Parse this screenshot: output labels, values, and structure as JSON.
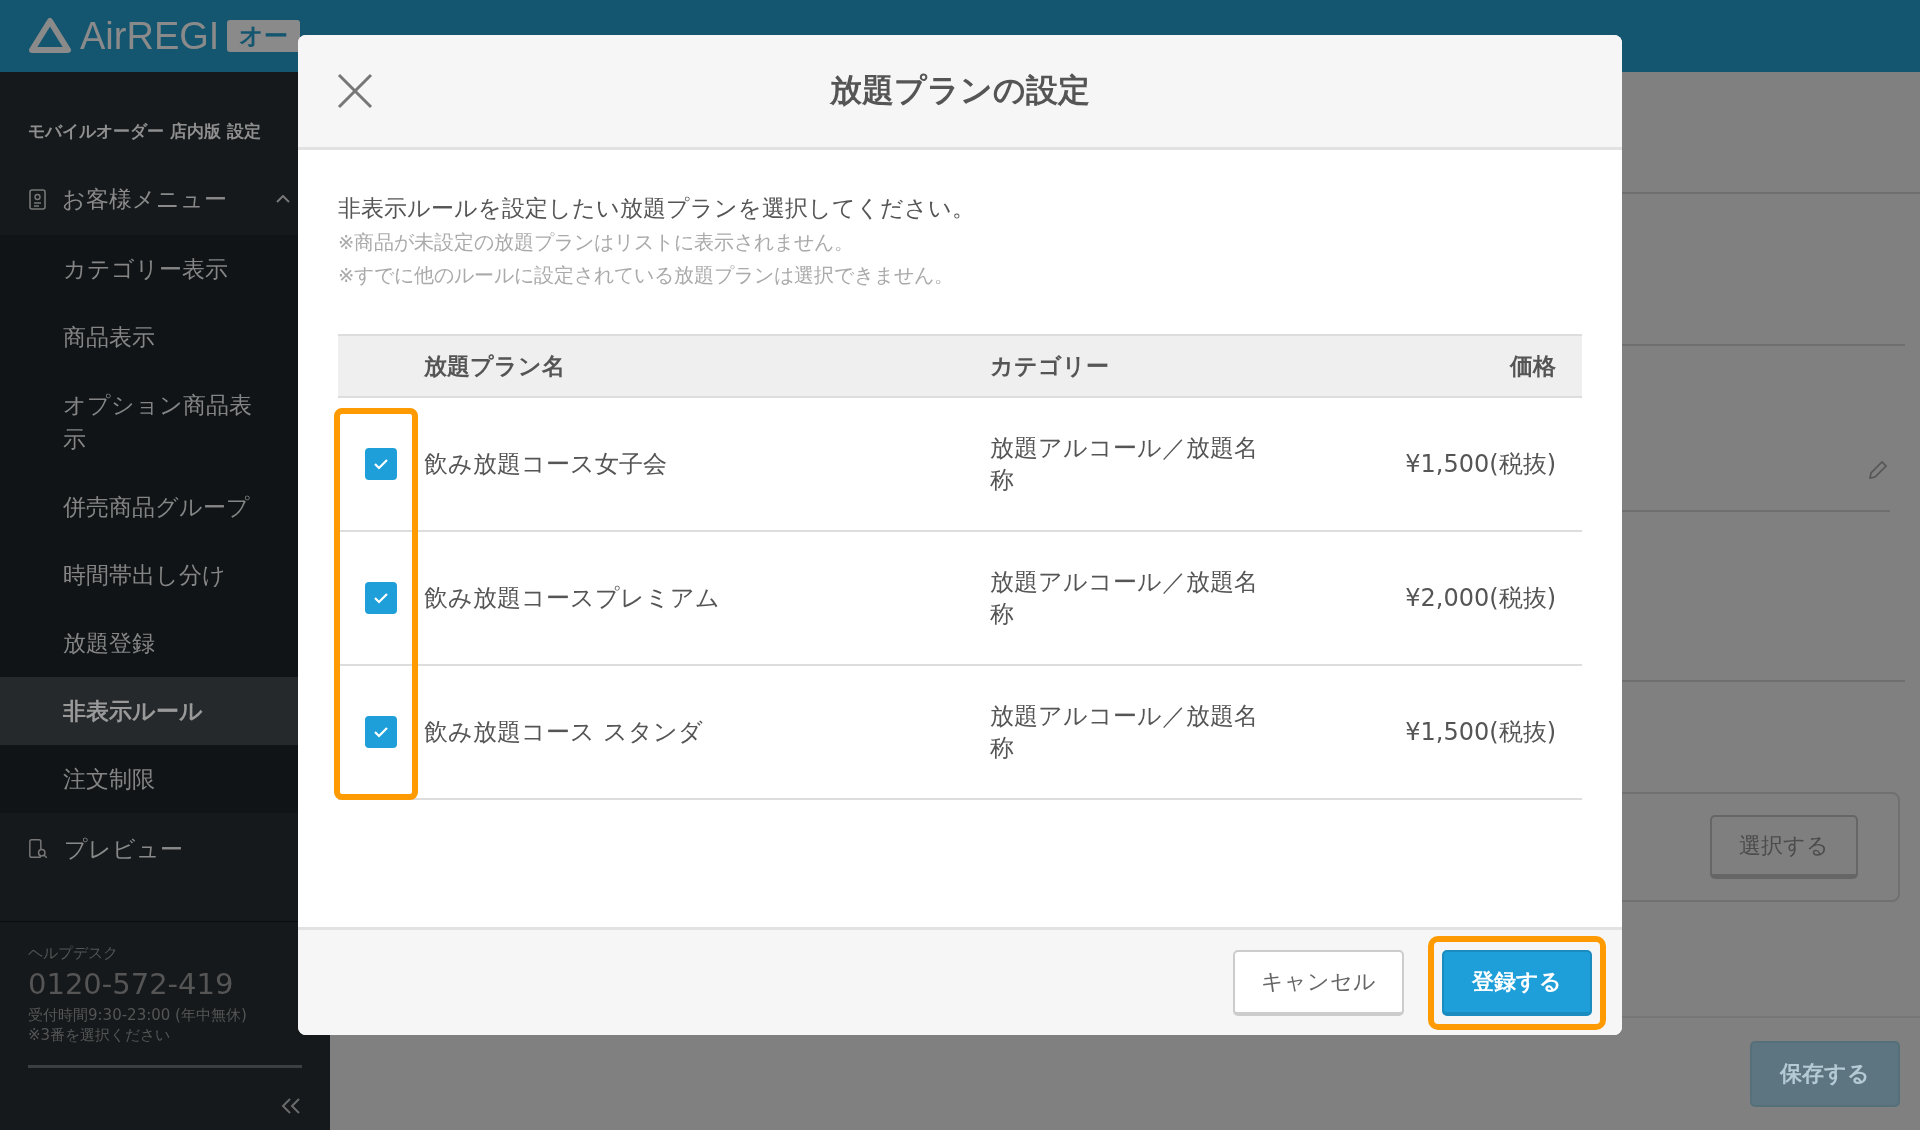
{
  "header": {
    "logo": "AirREGI",
    "logo_badge": "オー"
  },
  "sidebar": {
    "title": "モバイルオーダー 店内版 設定",
    "sections": [
      {
        "label": "お客様メニュー",
        "expanded": true,
        "children": [
          {
            "label": "カテゴリー表示",
            "selected": false
          },
          {
            "label": "商品表示",
            "selected": false
          },
          {
            "label": "オプション商品表示",
            "selected": false
          },
          {
            "label": "併売商品グループ",
            "selected": false
          },
          {
            "label": "時間帯出し分け",
            "selected": false
          },
          {
            "label": "放題登録",
            "selected": false
          },
          {
            "label": "非表示ルール",
            "selected": true
          },
          {
            "label": "注文制限",
            "selected": false
          }
        ]
      },
      {
        "label": "プレビュー"
      }
    ],
    "help": {
      "label": "ヘルプデスク",
      "phone": "0120-572-419",
      "hours": "受付時間9:30-23:00 (年中無休)",
      "note": "※3番を選択ください"
    }
  },
  "background": {
    "select_button": "選択する",
    "save_button": "保存する"
  },
  "dialog": {
    "title": "放題プランの設定",
    "intro": "非表示ルールを設定したい放題プランを選択してください。",
    "notes": [
      "※商品が未設定の放題プランはリストに表示されません。",
      "※すでに他のルールに設定されている放題プランは選択できません。"
    ],
    "table": {
      "columns": [
        "放題プラン名",
        "カテゴリー",
        "価格"
      ],
      "checkbox_column_highlighted": true,
      "rows": [
        {
          "checked": true,
          "name": "飲み放題コース女子会",
          "category": "放題アルコール／放題名称",
          "price": "¥1,500(税抜)"
        },
        {
          "checked": true,
          "name": "飲み放題コースプレミアム",
          "category": "放題アルコール／放題名称",
          "price": "¥2,000(税抜)"
        },
        {
          "checked": true,
          "name": "飲み放題コース スタンダ",
          "category": "放題アルコール／放題名称",
          "price": "¥1,500(税抜)"
        }
      ]
    },
    "buttons": [
      {
        "label": "キャンセル",
        "kind": "secondary",
        "highlighted": false
      },
      {
        "label": "登録する",
        "kind": "primary",
        "highlighted": true
      }
    ]
  }
}
